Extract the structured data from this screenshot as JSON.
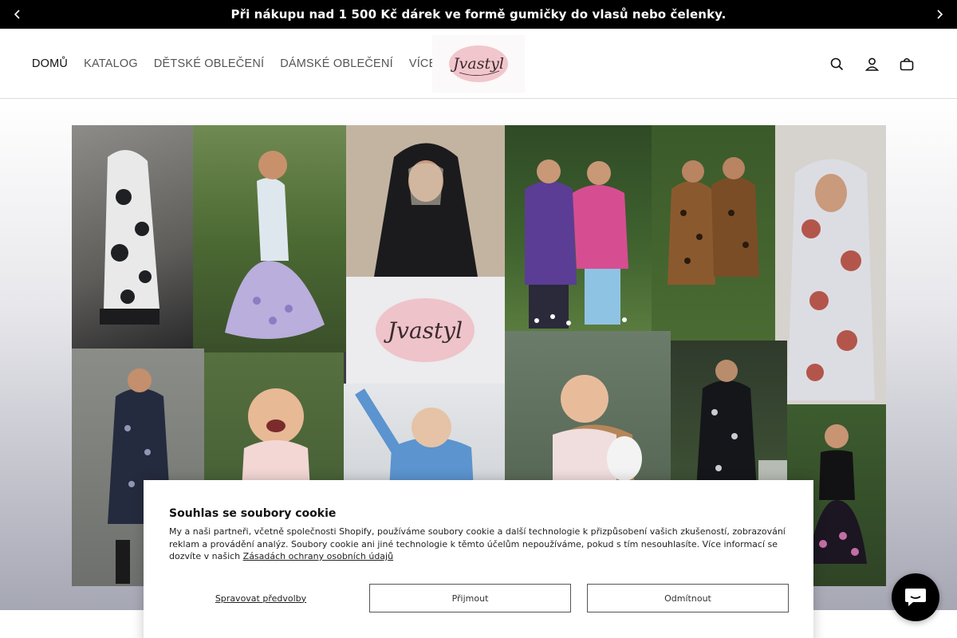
{
  "announcement": {
    "text": "Při nákupu nad 1 500 Kč dárek ve formě gumičky do vlasů nebo čelenky."
  },
  "header": {
    "nav": [
      {
        "label": "DOMŮ",
        "active": true
      },
      {
        "label": "KATALOG",
        "active": false
      },
      {
        "label": "DĚTSKÉ OBLEČENÍ",
        "active": false
      },
      {
        "label": "DÁMSKÉ OBLEČENÍ",
        "active": false
      },
      {
        "label": "VÍCE",
        "active": false
      }
    ],
    "logo_text": "Jvastyl",
    "icons": [
      "search-icon",
      "account-icon",
      "cart-icon"
    ]
  },
  "hero": {
    "collage_logo_text": "Jvastyl"
  },
  "cookie": {
    "title": "Souhlas se soubory cookie",
    "body": "My a naši partneři, včetně společnosti Shopify, používáme soubory cookie a další technologie k přizpůsobení vašich zkušeností, zobrazování reklam a provádění analýz. Soubory cookie ani jiné technologie k těmto účelům nepoužíváme, pokud s tím nesouhlasíte. Více informací se dozvíte v našich",
    "link": "Zásadách ochrany osobních údajů",
    "manage_label": "Spravovat předvolby",
    "accept_label": "Přijmout",
    "decline_label": "Odmítnout"
  },
  "colors": {
    "announcement_bg": "#000000",
    "logo_oval": "#f1c6cc",
    "chat_bg": "#000000"
  }
}
